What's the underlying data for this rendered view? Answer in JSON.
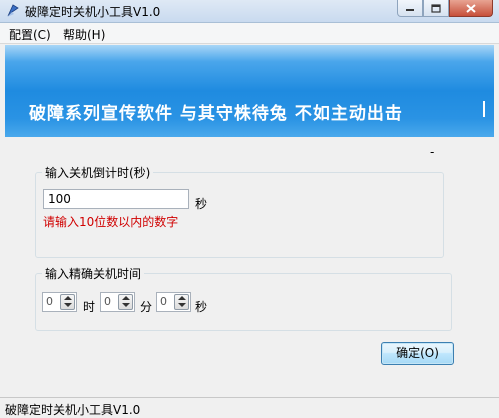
{
  "window": {
    "title": "破障定时关机小工具V1.0"
  },
  "menu": [
    {
      "label": "配置(C)"
    },
    {
      "label": "帮助(H)"
    }
  ],
  "banner": {
    "text": "破障系列宣传软件 与其守株待兔 不如主动出击"
  },
  "misc": {
    "dash": "-"
  },
  "countdown": {
    "group_title": "输入关机倒计时(秒)",
    "value": "100",
    "unit": "秒",
    "hint": "请输入10位数以内的数字"
  },
  "exact_time": {
    "group_title": "输入精确关机时间",
    "hour_value": "0",
    "hour_unit": "时",
    "minute_value": "0",
    "minute_unit": "分",
    "second_value": "0",
    "second_unit": "秒"
  },
  "ok_button": {
    "label": "确定(O)"
  },
  "status": {
    "text": "破障定时关机小工具V1.0"
  },
  "colors": {
    "banner": "#1f8be0",
    "hint": "#d00000"
  }
}
